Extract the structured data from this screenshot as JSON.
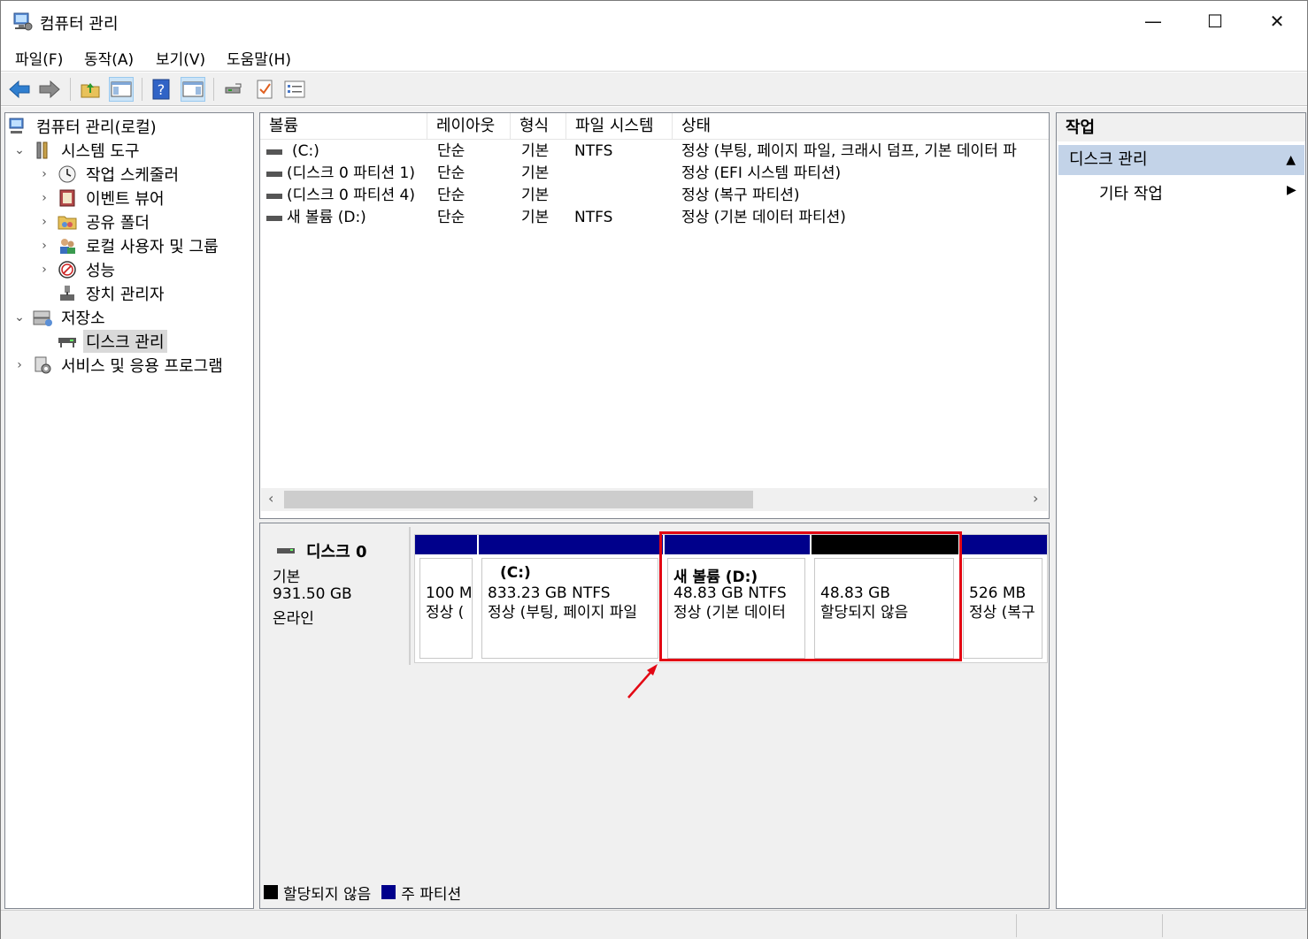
{
  "window": {
    "title": "컴퓨터 관리",
    "minimize": "—",
    "maximize": "☐",
    "close": "✕"
  },
  "menu": [
    "파일(F)",
    "동작(A)",
    "보기(V)",
    "도움말(H)"
  ],
  "toolbar_icons": [
    "back-arrow-icon",
    "forward-arrow-icon",
    "up-folder-icon",
    "show-hide-tree-icon",
    "help-icon",
    "show-action-pane-icon",
    "connect-icon",
    "properties-icon",
    "list-icon"
  ],
  "tree": {
    "root": "컴퓨터 관리(로컬)",
    "system_tools": "시스템 도구",
    "task_scheduler": "작업 스케줄러",
    "event_viewer": "이벤트 뷰어",
    "shared_folders": "공유 폴더",
    "local_users": "로컬 사용자 및 그룹",
    "performance": "성능",
    "device_manager": "장치 관리자",
    "storage": "저장소",
    "disk_management": "디스크 관리",
    "services": "서비스 및 응용 프로그램"
  },
  "volume_list": {
    "columns": [
      "볼륨",
      "레이아웃",
      "형식",
      "파일 시스템",
      "상태"
    ],
    "rows": [
      [
        "(C:)",
        "단순",
        "기본",
        "NTFS",
        "정상 (부팅, 페이지 파일, 크래시 덤프, 기본 데이터 파"
      ],
      [
        "(디스크 0 파티션 1)",
        "단순",
        "기본",
        "",
        "정상 (EFI 시스템 파티션)"
      ],
      [
        "(디스크 0 파티션 4)",
        "단순",
        "기본",
        "",
        "정상 (복구 파티션)"
      ],
      [
        "새 볼륨 (D:)",
        "단순",
        "기본",
        "NTFS",
        "정상 (기본 데이터 파티션)"
      ]
    ]
  },
  "disk": {
    "name": "디스크 0",
    "type": "기본",
    "size": "931.50 GB",
    "status": "온라인",
    "partitions": [
      {
        "title": "",
        "line1": "100 M",
        "line2": "정상 ("
      },
      {
        "title": "(C:)",
        "line1": "833.23 GB NTFS",
        "line2": "정상 (부팅, 페이지 파일"
      },
      {
        "title": "새 볼륨  (D:)",
        "line1": "48.83 GB NTFS",
        "line2": "정상 (기본 데이터"
      },
      {
        "title": "",
        "line1": "48.83 GB",
        "line2": "할당되지 않음"
      },
      {
        "title": "",
        "line1": "526 MB",
        "line2": "정상 (복구"
      }
    ]
  },
  "legend": {
    "unallocated": "할당되지 않음",
    "primary": "주 파티션"
  },
  "colors": {
    "primary": "#00008b",
    "unallocated": "#000000",
    "highlight": "#e30613",
    "action_header": "#c3d3e8"
  },
  "actions": {
    "header": "작업",
    "section": "디스크 관리",
    "item": "기타 작업"
  }
}
